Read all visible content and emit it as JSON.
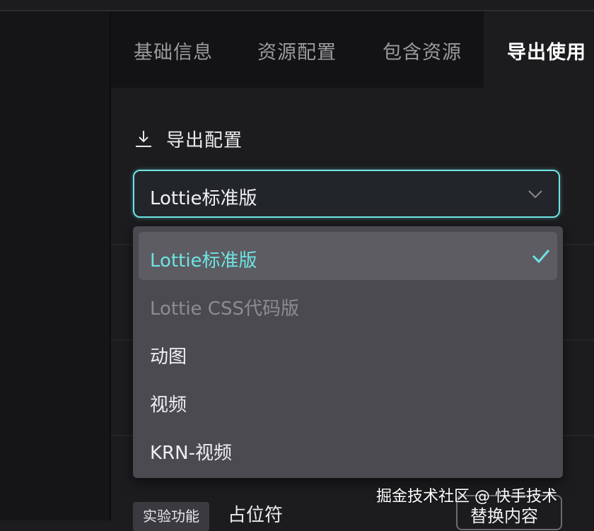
{
  "tabs": [
    {
      "label": "基础信息",
      "active": false
    },
    {
      "label": "资源配置",
      "active": false
    },
    {
      "label": "包含资源",
      "active": false
    },
    {
      "label": "导出使用",
      "active": true
    }
  ],
  "export_section": {
    "title": "导出配置",
    "icon": "download-icon"
  },
  "select": {
    "value": "Lottie标准版",
    "icon": "chevron-down-icon"
  },
  "dropdown": {
    "options": [
      {
        "label": "Lottie标准版",
        "state": "selected"
      },
      {
        "label": "Lottie CSS代码版",
        "state": "disabled"
      },
      {
        "label": "动图",
        "state": "normal"
      },
      {
        "label": "视频",
        "state": "normal"
      },
      {
        "label": "KRN-视频",
        "state": "normal"
      }
    ],
    "check_icon": "check-icon"
  },
  "bottom": {
    "badge": "实验功能",
    "label": "占位符",
    "replace_button": "替换内容"
  },
  "watermark": "掘金技术社区 @ 快手技术",
  "colors": {
    "accent": "#6fe3e3",
    "background": "#1c1c1f",
    "dropdown_bg": "#4a4a50",
    "selected_bg": "#5c5c62"
  }
}
